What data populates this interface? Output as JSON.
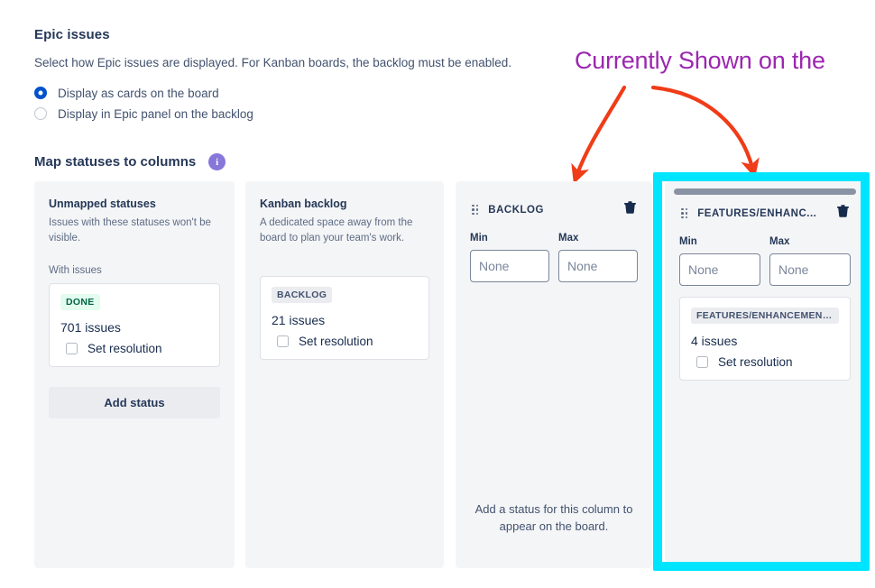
{
  "settings": {
    "title": "Epic issues",
    "description": "Select how Epic issues are displayed. For Kanban boards, the backlog must be enabled.",
    "options": [
      {
        "label": "Display as cards on the board",
        "selected": true
      },
      {
        "label": "Display in Epic panel on the backlog",
        "selected": false
      }
    ]
  },
  "map_section": {
    "title": "Map statuses to columns",
    "info_icon": "info-icon",
    "info_glyph": "i"
  },
  "annotation": {
    "text": "Currently Shown on the",
    "color": "#9c27b0",
    "arrow_color": "#f03c18",
    "highlight_color": "#00e5ff"
  },
  "columns": [
    {
      "kind": "unmapped",
      "heading": "Unmapped statuses",
      "subheading": "Issues with these statuses won't be visible.",
      "group_label": "With issues",
      "statuses": [
        {
          "badge": "DONE",
          "badge_style": "done",
          "issues": "701 issues",
          "resolution_label": "Set resolution",
          "resolution_checked": false
        }
      ],
      "add_button": "Add status"
    },
    {
      "kind": "backlog",
      "heading": "Kanban backlog",
      "subheading": "A dedicated space away from the board to plan your team's work.",
      "statuses": [
        {
          "badge": "BACKLOG",
          "badge_style": "grey",
          "issues": "21 issues",
          "resolution_label": "Set resolution",
          "resolution_checked": false
        }
      ]
    },
    {
      "kind": "mapped",
      "title": "BACKLOG",
      "drag_handle": "drag-handle-icon",
      "delete_icon": "trash-icon",
      "min_label": "Min",
      "min_value": "",
      "min_placeholder": "None",
      "max_label": "Max",
      "max_value": "",
      "max_placeholder": "None",
      "statuses": [],
      "empty_message": "Add a status for this column to appear on the board."
    },
    {
      "kind": "mapped",
      "title": "FEATURES/ENHANC...",
      "drag_handle": "drag-handle-icon",
      "delete_icon": "trash-icon",
      "min_label": "Min",
      "min_value": "",
      "min_placeholder": "None",
      "max_label": "Max",
      "max_value": "",
      "max_placeholder": "None",
      "statuses": [
        {
          "badge": "FEATURES/ENHANCEMENTS",
          "badge_style": "grey",
          "issues": "4 issues",
          "resolution_label": "Set resolution",
          "resolution_checked": false
        }
      ],
      "empty_message": ""
    }
  ]
}
